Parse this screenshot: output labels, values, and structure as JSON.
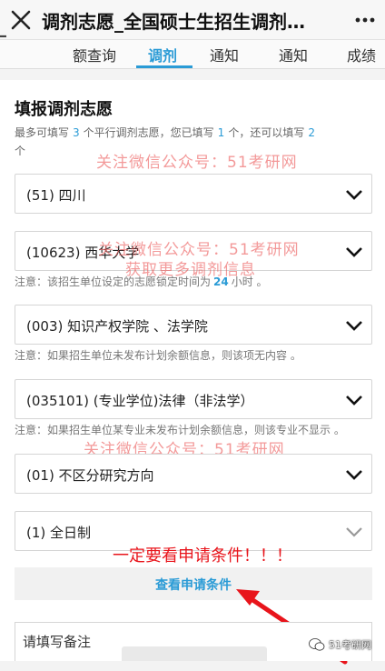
{
  "header": {
    "title": "调剂志愿_全国硕士生招生调剂…"
  },
  "tabs": [
    {
      "label": "额查询"
    },
    {
      "label": "调剂"
    },
    {
      "label": "通知"
    },
    {
      "label": "通知"
    },
    {
      "label": "成绩"
    }
  ],
  "form": {
    "heading": "填报调剂志愿",
    "quota": {
      "p1": "最多可填写",
      "max": "3",
      "p2": "个平行调剂志愿，您已填写",
      "filled": "1",
      "p3": "个，还可以填写",
      "remaining": "2",
      "p4": "个"
    },
    "fields": {
      "province": "(51) 四川",
      "school": "(10623) 西华大学",
      "department": "(003) 知识产权学院 、法学院",
      "major": "(035101) (专业学位)法律（非法学）",
      "direction": "(01) 不区分研究方向",
      "study_mode": "(1) 全日制"
    },
    "notes": {
      "lock_p1": "注意：该招生单位设定的志愿锁定时间为",
      "lock_hours": "24",
      "lock_p2": "小时 。",
      "dept": "注意：如果招生单位未发布计划余额信息，则该项无内容 。",
      "major": "注意：如果招生单位某专业未发布计划余额信息，则该专业不显示 。"
    },
    "view_conditions": "查看申请条件",
    "remark_label": "请填写备注"
  },
  "watermark": {
    "line1": "关注微信公众号：51考研网",
    "line2": "获取更多调剂信息"
  },
  "annotation": "一定要看申请条件！！！",
  "brand": "51考研网",
  "colors": {
    "accent": "#2a9bd6",
    "annotation": "#e8141b",
    "watermark": "#eb5a5a"
  }
}
